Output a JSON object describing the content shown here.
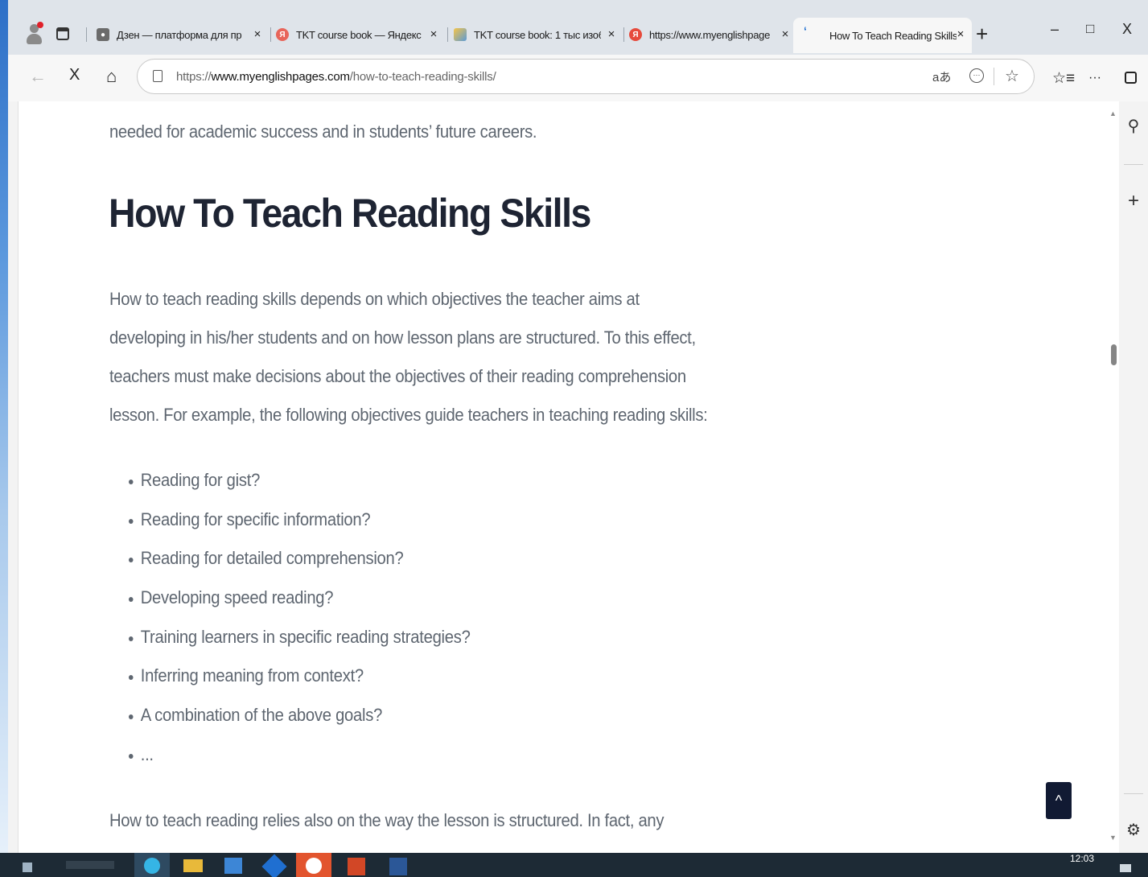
{
  "tabs": [
    {
      "title": "Дзен — платформа для пр",
      "favicon_color": "#6b6b6b"
    },
    {
      "title": "TKT course book — Яндекс",
      "favicon_color": "#e8655a",
      "favicon_glyph": "Я"
    },
    {
      "title": "TKT course book: 1 тыс изоб",
      "favicon_color": "#e9a74b"
    },
    {
      "title": "https://www.myenglishpage",
      "favicon_color": "#e64a3c",
      "favicon_glyph": "Я"
    },
    {
      "title": "How To Teach Reading Skills",
      "favicon_color": "#1f6fd1",
      "active": true
    }
  ],
  "address": {
    "prefix": "https://",
    "host": "www.myenglishpages.com",
    "path": "/how-to-teach-reading-skills/"
  },
  "page": {
    "prev_line": "needed for academic success and in students’ future careers.",
    "heading": "How To Teach Reading Skills",
    "intro_lines": [
      "How to teach reading skills depends on which objectives the teacher aims at",
      "developing in his/her students and on how lesson plans are structured. To this effect,",
      "teachers must make decisions about the objectives of their reading comprehension",
      "lesson. For example, the following objectives guide teachers in teaching reading skills:"
    ],
    "goals": [
      "Reading for gist?",
      "Reading for specific information?",
      "Reading for detailed comprehension?",
      "Developing speed reading?",
      "Training learners in specific reading strategies?",
      "Inferring meaning from context?",
      "A combination of the above goals?",
      "..."
    ],
    "bottom_line": "How to teach reading relies also on the way the lesson is structured. In fact, any"
  },
  "taskbar": {
    "time": "12:03"
  },
  "icons": {
    "close_tab": "×",
    "new_tab": "+",
    "minimize": "–",
    "maximize": "□",
    "close_window": "X",
    "back": "←",
    "stop": "X",
    "home": "⌂",
    "read_aloud": "aあ",
    "more": "···",
    "scroll_top": "^"
  },
  "colors": {
    "heading": "#1e2433",
    "body_text": "#5e6670",
    "to_top_button": "#111a33",
    "taskbar": "#1d2a35"
  }
}
